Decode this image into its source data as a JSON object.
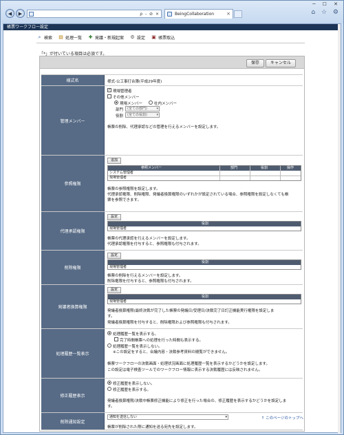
{
  "browser": {
    "tab_title": "BeingCollaboration",
    "address_buttons": "ρ - ⊘ ×",
    "window_controls": "─ ☐ ✕",
    "toolbar_icons": "⌂ ☆ ⚙"
  },
  "page": {
    "title": "帳票ワークフロー設定",
    "toolbar": [
      {
        "label": "検索",
        "icon": "search-icon"
      },
      {
        "label": "処理一覧",
        "icon": "list-icon"
      },
      {
        "label": "発議・新規起案",
        "icon": "new-document-icon"
      },
      {
        "label": "設定",
        "icon": "settings-icon"
      },
      {
        "label": "帳票取込",
        "icon": "import-icon"
      }
    ],
    "required_notice": "「*」が付いている項目は必須です。",
    "buttons": {
      "save": "保存",
      "cancel": "キャンセル"
    },
    "top_link": "↑ このページのトップへ"
  },
  "form": {
    "template": {
      "label": "様式名",
      "value": "様式-公工事打合簿(平成29年度)"
    },
    "managers": {
      "label": "管理メンバー",
      "site_manager": "現場管理者",
      "other_member": "その他メンバー",
      "radio_site": "現場メンバー",
      "radio_company": "社内メンバー",
      "dept_label": "部門",
      "dept_value": "(全ての部門)",
      "role_label": "役割",
      "role_value": "(全ての役割)",
      "note": "帳票の削除、代理承認などの管理を行えるメンバーを設定します。"
    },
    "view_rights": {
      "label": "参照権限",
      "add_button": "追加",
      "columns": [
        "参照メンバー",
        "部門",
        "役割",
        "操作"
      ],
      "rows": [
        "システム管理者",
        "現場管理者"
      ],
      "note1": "帳票の参照権限を設定します。",
      "note2": "代理承認権限、削除権限、発議者換算権限のいずれかが設定されている場合、参照権限を設定しなくても帳",
      "note3": "票を参照できます。"
    },
    "proxy": {
      "label": "代理承認権限",
      "set_button": "設定",
      "column": "役割",
      "row": "現場管理者",
      "note1": "帳票の代理承認を行えるメンバーを設定します。",
      "note2": "代理承認権限を付与すると、参照権限も付与されます。"
    },
    "delete": {
      "label": "削除権限",
      "set_button": "設定",
      "column": "役割",
      "row": "現場管理者",
      "note1": "帳票の削除を行えるメンバーを設定します。",
      "note2": "削除権限を付与すると、参照権限も付与されます。"
    },
    "initiator": {
      "label": "発議者換算権限",
      "set_button": "設定",
      "column": "役割",
      "row": "現場管理者",
      "note1": "発議者換算権限(最終決裁が完了した帳票の発議日/受理日/決裁完了日訂正機能実行権限を設定しま",
      "note2": "す。",
      "note3": "発議者換算権限を付与すると、削除権限および参照権限も付与されます。"
    },
    "history": {
      "label": "処理履歴一覧表示",
      "opt_show": "処理履歴一覧を表示する。",
      "opt_time": "完了時間帳票への処理を行った時間も表示する。",
      "opt_hide": "処理履歴一覧を表示しない。",
      "opt_hide_note": "※この設定をすると、合議内容・決裁参考資料の閲覧ができません。",
      "note1": "帳票ワークフローの決裁画面・処理状況画面に処理履歴一覧を表示するかどうかを設定します。",
      "note2": "この設定は電子検査ツールでのワークフロー情報に表示する決裁履歴には反映されません。"
    },
    "revision": {
      "label": "修正履歴表示",
      "opt_hide": "修正履歴を表示しない。",
      "opt_show": "修正履歴を表示する。",
      "note": "発議者換算権限/決裁中帳票修正機能により修正を行った場合の、修正履歴を表示するかどうかを設定しま",
      "note2": "す。"
    },
    "delete_notify": {
      "label": "削除通知設定",
      "select_value": "通知を送信しない",
      "note": "帳票が削除された際に通知を送る宛先を設定します。"
    }
  }
}
